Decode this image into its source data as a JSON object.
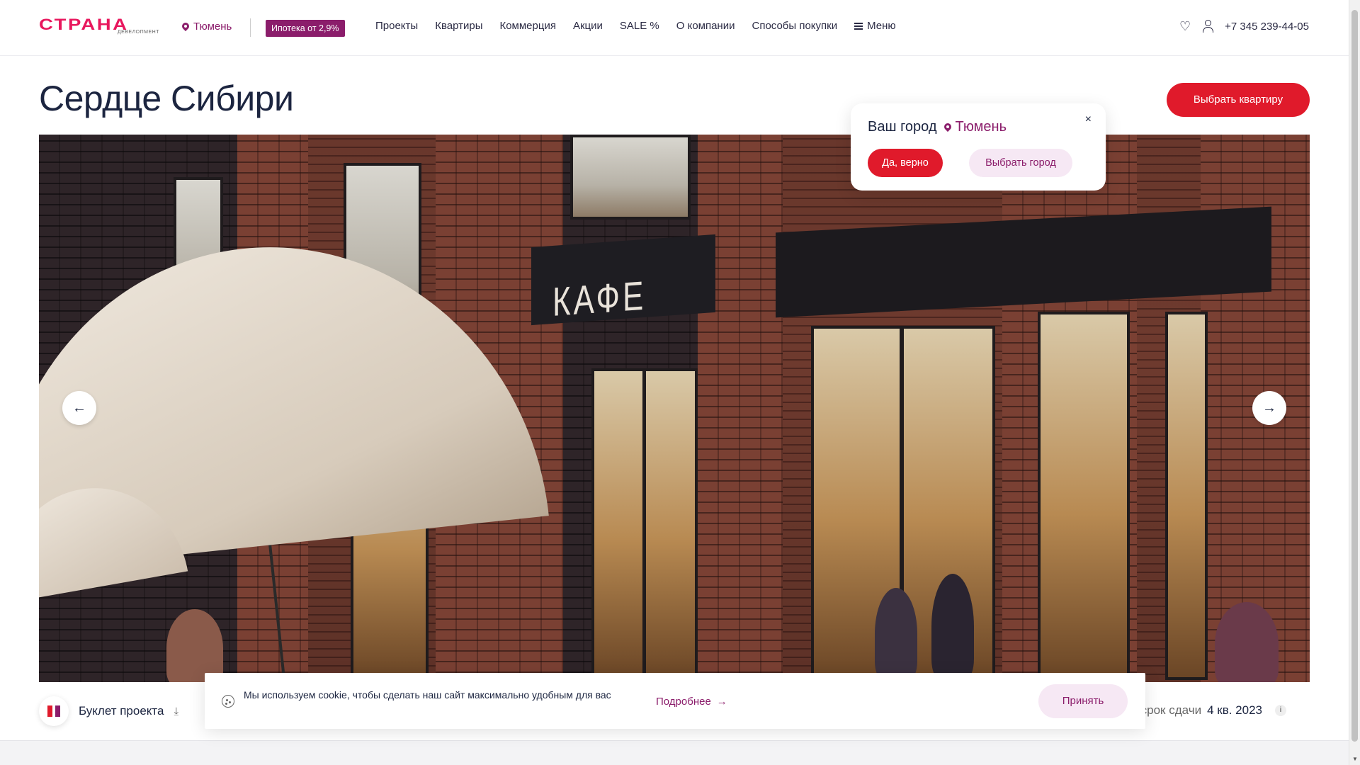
{
  "header": {
    "logo_text": "СТРАНА",
    "logo_sub": "ДЕВЕЛОПМЕНТ",
    "city": "Тюмень",
    "promo": "Ипотека от 2,9%",
    "nav": [
      "Проекты",
      "Квартиры",
      "Коммерция",
      "Акции",
      "SALE %",
      "О компании",
      "Способы покупки"
    ],
    "menu_label": "Меню",
    "phone": "+7 345 239-44-05"
  },
  "main": {
    "title": "Сердце Сибири",
    "cta": "Выбрать квартиру",
    "hero_sign": "КАФЕ",
    "booklet": "Буклет проекта",
    "deadline_label": "ий срок сдачи",
    "deadline_value": "4 кв. 2023"
  },
  "city_popup": {
    "question": "Ваш город",
    "city": "Тюмень",
    "confirm": "Да, верно",
    "choose": "Выбрать город",
    "close": "×"
  },
  "cookie": {
    "text": "Мы используем cookie, чтобы сделать наш сайт максимально удобным для вас",
    "more": "Подробнее",
    "accept": "Принять"
  },
  "colors": {
    "brand_pink": "#e8175d",
    "brand_purple": "#8b1d6b",
    "cta_red": "#e01a2b"
  }
}
